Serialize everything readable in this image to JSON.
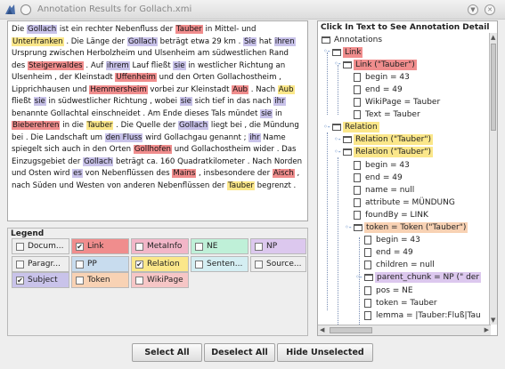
{
  "window": {
    "title": "Annotation Results for Gollach.xmi",
    "controls": [
      "▼",
      "✕"
    ]
  },
  "text_pane": {
    "segments": [
      {
        "t": "Die "
      },
      {
        "t": "Gollach",
        "c": "#c9c3ea"
      },
      {
        "t": " ist ein rechter Nebenfluss der "
      },
      {
        "t": "Tauber",
        "c": "#f08d8d"
      },
      {
        "t": " in Mittel- und "
      },
      {
        "t": "Unterfranken",
        "c": "#fbe78a"
      },
      {
        "t": " . Die Länge der "
      },
      {
        "t": "Gollach",
        "c": "#c9c3ea"
      },
      {
        "t": " beträgt etwa 29 km . "
      },
      {
        "t": "Sie",
        "c": "#c9c3ea"
      },
      {
        "t": " hat "
      },
      {
        "t": "ihren",
        "c": "#c9c3ea"
      },
      {
        "t": " Ursprung zwischen Herbolzheim und Ulsenheim am südwestlichen Rand des "
      },
      {
        "t": "Steigerwaldes",
        "c": "#f08d8d"
      },
      {
        "t": " . Auf "
      },
      {
        "t": "ihrem",
        "c": "#c9c3ea"
      },
      {
        "t": " Lauf fließt "
      },
      {
        "t": "sie",
        "c": "#c9c3ea"
      },
      {
        "t": " in westlicher Richtung an Ulsenheim , der Kleinstadt "
      },
      {
        "t": "Uffenheim",
        "c": "#f08d8d"
      },
      {
        "t": " und den Orten Gollachostheim , Lipprichhausen und "
      },
      {
        "t": "Hemmersheim",
        "c": "#f08d8d"
      },
      {
        "t": " vorbei zur Kleinstadt "
      },
      {
        "t": "Aub",
        "c": "#f08d8d"
      },
      {
        "t": " . Nach "
      },
      {
        "t": "Aub",
        "c": "#fbe78a"
      },
      {
        "t": " fließt "
      },
      {
        "t": "sie",
        "c": "#c9c3ea"
      },
      {
        "t": " in südwestlicher Richtung , wobei "
      },
      {
        "t": "sie",
        "c": "#c9c3ea"
      },
      {
        "t": " sich tief in das nach "
      },
      {
        "t": "ihr",
        "c": "#c9c3ea"
      },
      {
        "t": " benannte Gollachtal einschneidet . Am Ende dieses Tals mündet "
      },
      {
        "t": "sie",
        "c": "#c9c3ea"
      },
      {
        "t": " in "
      },
      {
        "t": "Bieberehren",
        "c": "#f08d8d"
      },
      {
        "t": " in die "
      },
      {
        "t": "Tauber",
        "c": "#fbe78a"
      },
      {
        "t": " . Die Quelle der "
      },
      {
        "t": "Gollach",
        "c": "#c9c3ea"
      },
      {
        "t": " liegt bei , die Mündung bei . Die Landschaft um "
      },
      {
        "t": "den Fluss",
        "c": "#c9c3ea"
      },
      {
        "t": " wird Gollachgau genannt ; "
      },
      {
        "t": "ihr",
        "c": "#c9c3ea"
      },
      {
        "t": " Name spiegelt sich auch in den Orten "
      },
      {
        "t": "Gollhofen",
        "c": "#f08d8d"
      },
      {
        "t": " und Gollachostheim wider . Das Einzugsgebiet der "
      },
      {
        "t": "Gollach",
        "c": "#c9c3ea"
      },
      {
        "t": " beträgt ca. 160 Quadratkilometer . Nach Norden und Osten wird "
      },
      {
        "t": "es",
        "c": "#c9c3ea"
      },
      {
        "t": " von Nebenflüssen des "
      },
      {
        "t": "Mains",
        "c": "#f08d8d"
      },
      {
        "t": " , insbesondere der "
      },
      {
        "t": "Aisch",
        "c": "#f08d8d"
      },
      {
        "t": " , nach Süden und Westen von anderen Nebenflüssen der "
      },
      {
        "t": "Tauber",
        "c": "#fbe78a"
      },
      {
        "t": " begrenzt ."
      }
    ]
  },
  "legend": {
    "title": "Legend",
    "items": [
      {
        "label": "Docum...",
        "checked": false,
        "color": "#eeeeee"
      },
      {
        "label": "Link",
        "checked": true,
        "color": "#f08d8d"
      },
      {
        "label": "MetaInfo",
        "checked": false,
        "color": "#f2b6c8"
      },
      {
        "label": "NE",
        "checked": false,
        "color": "#bff0d8"
      },
      {
        "label": "NP",
        "checked": false,
        "color": "#dcc8ee"
      },
      {
        "label": "Paragr...",
        "checked": false,
        "color": "#eeeeee"
      },
      {
        "label": "PP",
        "checked": false,
        "color": "#c8dcee"
      },
      {
        "label": "Relation",
        "checked": true,
        "color": "#fbe78a"
      },
      {
        "label": "Senten...",
        "checked": false,
        "color": "#d4eef2"
      },
      {
        "label": "Source...",
        "checked": false,
        "color": "#eeeeee"
      },
      {
        "label": "Subject",
        "checked": true,
        "color": "#c9c3ea"
      },
      {
        "label": "Token",
        "checked": false,
        "color": "#f8d2b4"
      },
      {
        "label": "WikiPage",
        "checked": false,
        "color": "#f6c6c6"
      }
    ]
  },
  "tree": {
    "header": "Click In Text to See Annotation Detail",
    "rows": [
      {
        "label": "Annotations",
        "kind": "folder",
        "toggle": "",
        "bg": ""
      },
      {
        "label": "Link",
        "kind": "folder",
        "toggle": "◦-",
        "bg": "#f08d8d"
      },
      {
        "label": "Link (\"Tauber\")",
        "kind": "folder",
        "toggle": "◦-",
        "bg": "#f08d8d"
      },
      {
        "label": "begin = 43",
        "kind": "leaf",
        "toggle": "",
        "bg": ""
      },
      {
        "label": "end = 49",
        "kind": "leaf",
        "toggle": "",
        "bg": ""
      },
      {
        "label": "WikiPage = Tauber",
        "kind": "leaf",
        "toggle": "",
        "bg": ""
      },
      {
        "label": "Text = Tauber",
        "kind": "leaf",
        "toggle": "",
        "bg": ""
      },
      {
        "label": "Relation",
        "kind": "folder",
        "toggle": "◦-",
        "bg": "#fbe78a"
      },
      {
        "label": "Relation (\"Tauber\")",
        "kind": "folder",
        "toggle": "◦-",
        "bg": "#fbe78a"
      },
      {
        "label": "Relation (\"Tauber\")",
        "kind": "folder",
        "toggle": "◦-",
        "bg": "#fbe78a"
      },
      {
        "label": "begin = 43",
        "kind": "leaf",
        "toggle": "",
        "bg": ""
      },
      {
        "label": "end = 49",
        "kind": "leaf",
        "toggle": "",
        "bg": ""
      },
      {
        "label": "name = null",
        "kind": "leaf",
        "toggle": "",
        "bg": ""
      },
      {
        "label": "attribute = MÜNDUNG",
        "kind": "leaf",
        "toggle": "",
        "bg": ""
      },
      {
        "label": "foundBy = LINK",
        "kind": "leaf",
        "toggle": "",
        "bg": ""
      },
      {
        "label": "token = Token (\"Tauber\")",
        "kind": "folder",
        "toggle": "◦-",
        "bg": "#f8d2b4"
      },
      {
        "label": "begin = 43",
        "kind": "leaf",
        "toggle": "",
        "bg": ""
      },
      {
        "label": "end = 49",
        "kind": "leaf",
        "toggle": "",
        "bg": ""
      },
      {
        "label": "children = null",
        "kind": "leaf",
        "toggle": "",
        "bg": ""
      },
      {
        "label": "parent_chunk = NP (\" der",
        "kind": "folder",
        "toggle": "◦-",
        "bg": "#dcc8ee"
      },
      {
        "label": "pos = NE",
        "kind": "leaf",
        "toggle": "",
        "bg": ""
      },
      {
        "label": "token = Tauber",
        "kind": "leaf",
        "toggle": "",
        "bg": ""
      },
      {
        "label": "lemma = |Tauber:Fluß|Tau",
        "kind": "leaf",
        "toggle": "",
        "bg": ""
      }
    ]
  },
  "buttons": {
    "select_all": "Select All",
    "deselect_all": "Deselect All",
    "hide_unselected": "Hide Unselected"
  }
}
